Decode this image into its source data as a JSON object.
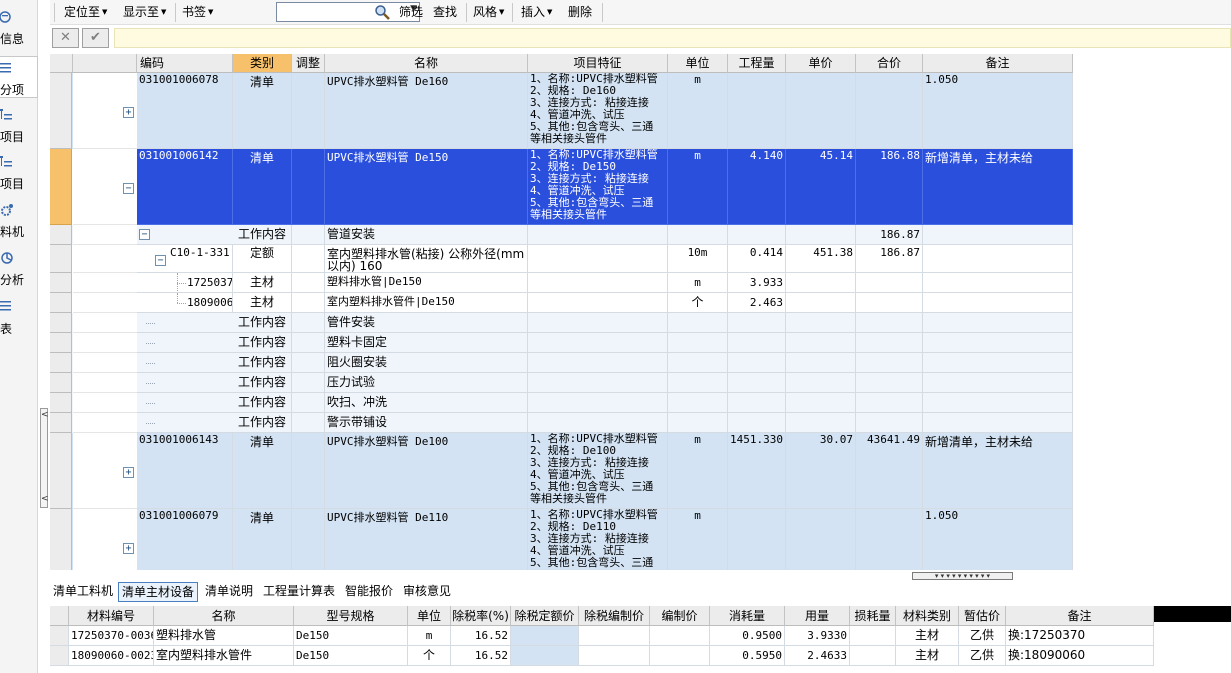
{
  "left_nav": {
    "items": [
      {
        "label": "信息",
        "icon": "info-icon"
      },
      {
        "label": "分项",
        "icon": "list-icon"
      },
      {
        "label": "项目",
        "icon": "tree-list-icon"
      },
      {
        "label": "项目",
        "icon": "tree-list-icon"
      },
      {
        "label": "料机",
        "icon": "gear-icon"
      },
      {
        "label": "分析",
        "icon": "analysis-icon"
      },
      {
        "label": "表",
        "icon": "report-icon"
      }
    ],
    "collapse_arrows": [
      "<",
      "<"
    ]
  },
  "toolbar": {
    "locate_label": "定位至",
    "show_label": "显示至",
    "bookmark_label": "书签",
    "bookmark_value": "",
    "filter_label": "筛选",
    "find_label": "查找",
    "style_label": "风格",
    "insert_label": "插入",
    "delete_label": "删除"
  },
  "editbar": {
    "cancel_glyph": "✕",
    "confirm_glyph": "✔"
  },
  "grid": {
    "columns": [
      "编码",
      "类别",
      "调整",
      "名称",
      "项目特征",
      "单位",
      "工程量",
      "单价",
      "合价",
      "备注"
    ],
    "rows": [
      {
        "code": "031001006078",
        "type": "清单",
        "name": "UPVC排水塑料管 De160",
        "features": [
          "1、名称:UPVC排水塑料管",
          "2、规格: De160",
          "3、连接方式: 粘接连接",
          "4、管道冲洗、试压",
          "5、其他:包含弯头、三通",
          "等相关接头管件"
        ],
        "unit": "m",
        "qty": "",
        "price": "",
        "total": "",
        "remark": "1.050"
      },
      {
        "code": "031001006142",
        "type": "清单",
        "name": "UPVC排水塑料管 De150",
        "features": [
          "1、名称:UPVC排水塑料管",
          "2、规格: De150",
          "3、连接方式: 粘接连接",
          "4、管道冲洗、试压",
          "5、其他:包含弯头、三通",
          "等相关接头管件"
        ],
        "unit": "m",
        "qty": "4.140",
        "price": "45.14",
        "total": "186.88",
        "remark": "新增清单，主材未给"
      },
      {
        "code": "",
        "type": "工作内容",
        "name": "管道安装",
        "unit": "",
        "qty": "",
        "price": "",
        "total": "186.87",
        "remark": ""
      },
      {
        "code": "C10-1-331",
        "type": "定额",
        "name": "室内塑料排水管(粘接) 公称外径(mm",
        "name2": "以内) 160",
        "unit": "10m",
        "qty": "0.414",
        "price": "451.38",
        "total": "186.87",
        "remark": ""
      },
      {
        "code": "1725037",
        "type": "主材",
        "name": "塑料排水管|De150",
        "unit": "m",
        "qty": "3.933",
        "price": "",
        "total": "",
        "remark": ""
      },
      {
        "code": "1809006",
        "type": "主材",
        "name": "室内塑料排水管件|De150",
        "unit": "个",
        "qty": "2.463",
        "price": "",
        "total": "",
        "remark": ""
      },
      {
        "code": "",
        "type": "工作内容",
        "name": "管件安装"
      },
      {
        "code": "",
        "type": "工作内容",
        "name": "塑料卡固定"
      },
      {
        "code": "",
        "type": "工作内容",
        "name": "阻火圈安装"
      },
      {
        "code": "",
        "type": "工作内容",
        "name": "压力试验"
      },
      {
        "code": "",
        "type": "工作内容",
        "name": "吹扫、冲洗"
      },
      {
        "code": "",
        "type": "工作内容",
        "name": "警示带铺设"
      },
      {
        "code": "031001006143",
        "type": "清单",
        "name": "UPVC排水塑料管 De100",
        "features": [
          "1、名称:UPVC排水塑料管",
          "2、规格: De100",
          "3、连接方式: 粘接连接",
          "4、管道冲洗、试压",
          "5、其他:包含弯头、三通",
          "等相关接头管件"
        ],
        "unit": "m",
        "qty": "1451.330",
        "price": "30.07",
        "total": "43641.49",
        "remark": "新增清单，主材未给"
      },
      {
        "code": "031001006079",
        "type": "清单",
        "name": "UPVC排水塑料管 De110",
        "features": [
          "1、名称:UPVC排水塑料管",
          "2、规格: De110",
          "3、连接方式: 粘接连接",
          "4、管道冲洗、试压",
          "5、其他:包含弯头、三通"
        ],
        "unit": "m",
        "qty": "",
        "price": "",
        "total": "",
        "remark": "1.050"
      }
    ]
  },
  "bottom_tabs": [
    "清单工料机",
    "清单主材设备",
    "清单说明",
    "工程量计算表",
    "智能报价",
    "审核意见"
  ],
  "bottom_tabs_active": "清单主材设备",
  "materials": {
    "columns": [
      "材料编号",
      "名称",
      "型号规格",
      "单位",
      "除税率(%)",
      "除税定额价",
      "除税编制价",
      "编制价",
      "消耗量",
      "用量",
      "损耗量",
      "材料类别",
      "暂估价",
      "备注"
    ],
    "rows": [
      {
        "code": "17250370-0036",
        "name": "塑料排水管",
        "spec": "De150",
        "unit": "m",
        "tax_rate": "16.52",
        "consumption": "0.9500",
        "usage": "3.9330",
        "category": "主材",
        "estimate": "乙供",
        "remark": "换:17250370"
      },
      {
        "code": "18090060-0023",
        "name": "室内塑料排水管件",
        "spec": "De150",
        "unit": "个",
        "tax_rate": "16.52",
        "consumption": "0.5950",
        "usage": "2.4633",
        "category": "主材",
        "estimate": "乙供",
        "remark": "换:18090060"
      }
    ]
  },
  "colors": {
    "selected_row": "#2a4fdc",
    "list_row": "#d3e3f3",
    "header_selected": "#f7c06a",
    "edit_input": "#fffbe1"
  }
}
